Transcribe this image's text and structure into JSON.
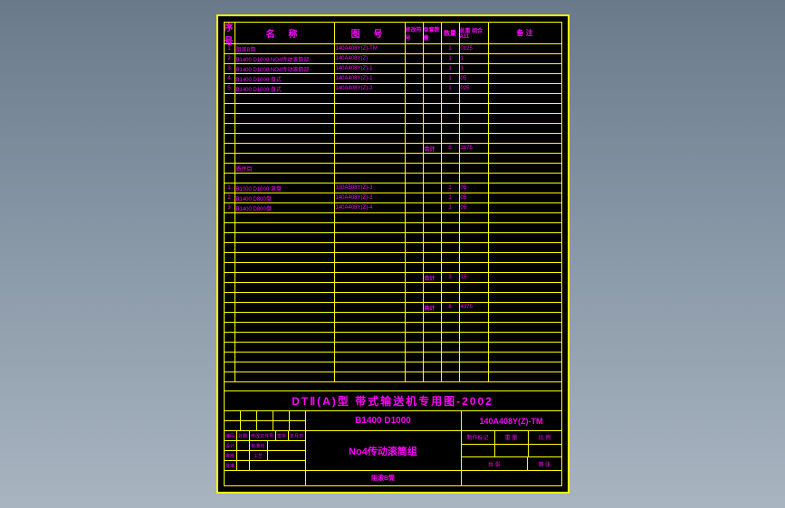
{
  "header": {
    "c0": "序号",
    "c1": "名    称",
    "c2": "图    号",
    "c3": "修改符号",
    "c4": "单套数量",
    "c5": "数量",
    "c6": "总重\n综合A11",
    "c7": "备  注"
  },
  "rows": [
    {
      "n": "1",
      "name": "阻滚B筒",
      "code": "140A408Y(Z)-TM",
      "q": "1",
      "w": "0125"
    },
    {
      "n": "2",
      "name": "B1400 D1000 NO4传动滚筒部",
      "code": "140A408Y(Z)",
      "q": "1",
      "w": "1"
    },
    {
      "n": "3",
      "name": "B1400 D1000 NO4传动滚筒部",
      "code": "140A408Y(Z)-1",
      "q": "1",
      "w": "1"
    },
    {
      "n": "4",
      "name": "B1400 D1000 盘式",
      "code": "140A408Y(Z)-1",
      "q": "1",
      "w": "05"
    },
    {
      "n": "5",
      "name": "B1400 D1000 盘式",
      "code": "140A408Y(Z)-2",
      "q": "1",
      "w": "025"
    },
    {},
    {},
    {},
    {},
    {},
    {
      "sum": "合计",
      "q": "5",
      "w": "2875"
    },
    {},
    {
      "name": "质件目"
    },
    {},
    {
      "n": "1",
      "name": "B1000 D1000 滚盘",
      "code": "100A508Y(Z)-3",
      "q": "1",
      "w": "05"
    },
    {
      "n": "2",
      "name": "B1400 D800盘",
      "code": "140A408Y(Z)-3",
      "q": "1",
      "w": "05"
    },
    {
      "n": "3",
      "name": "B1400 D800盘",
      "code": "140A408Y(Z)-4",
      "q": "1",
      "w": "05"
    },
    {},
    {},
    {},
    {},
    {},
    {},
    {
      "sum": "合计",
      "q": "3",
      "w": "15"
    },
    {},
    {},
    {
      "sum": "共计",
      "q": "8",
      "w": "4375"
    },
    {},
    {},
    {},
    {},
    {},
    {},
    {}
  ],
  "title": {
    "main": "DTⅡ(A)型  带式输送机专用图-2002",
    "mid1": "B1400  D1000",
    "right1": "140A408Y(Z)-TM",
    "mid2": "No4传动滚筒组",
    "sig": {
      "r1c1": "编码",
      "r1c2": "处数",
      "r1c3": "修改文件号",
      "r1c4": "签字",
      "r1c5": "年月日",
      "r2c1": "设计",
      "r2c2": "标准化",
      "r3c1": "审核",
      "r3c2": "工艺",
      "r4c1": "批准"
    },
    "rlabels": {
      "a": "制作标记",
      "b": "重  量",
      "c": "比  例",
      "d": "共  张",
      "e": "第  张"
    },
    "foot": "阻滚B筒"
  }
}
